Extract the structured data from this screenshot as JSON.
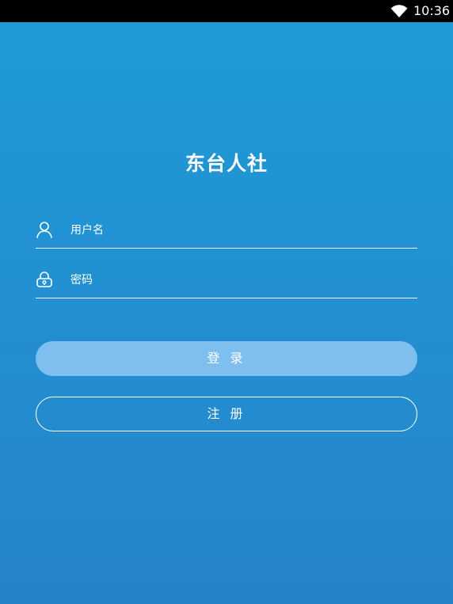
{
  "status_bar": {
    "time": "10:36",
    "wifi_icon": "wifi-icon"
  },
  "app": {
    "title": "东台人社"
  },
  "login_form": {
    "username": {
      "icon": "user-icon",
      "placeholder": "用户名",
      "value": ""
    },
    "password": {
      "icon": "lock-icon",
      "placeholder": "密码",
      "value": ""
    },
    "login_label": "登 录",
    "register_label": "注 册"
  },
  "colors": {
    "background_top": "#1f9bd6",
    "background_bottom": "#2584c8",
    "login_button": "#7fbff0",
    "text": "#ffffff"
  }
}
